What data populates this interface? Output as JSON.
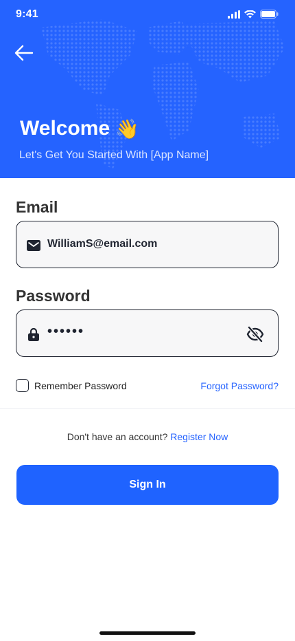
{
  "status_bar": {
    "time": "9:41",
    "icons": [
      "signal-icon",
      "wifi-icon",
      "battery-icon"
    ]
  },
  "header": {
    "back_icon": "arrow-left-icon",
    "title": "Welcome",
    "emoji": "👋",
    "subtitle": "Let's Get You Started With [App Name]"
  },
  "form": {
    "email": {
      "label": "Email",
      "value": "WilliamS@email.com",
      "icon": "envelope-icon"
    },
    "password": {
      "label": "Password",
      "masked_value": "••••••",
      "icon": "lock-icon",
      "toggle_icon": "eye-off-icon"
    },
    "remember": {
      "label": "Remember Password",
      "checked": false
    },
    "forgot_link": "Forgot Password?"
  },
  "register": {
    "prompt": "Don't have an account?",
    "link": "Register Now"
  },
  "signin_button": "Sign In",
  "colors": {
    "primary": "#2563ff",
    "text": "#1f2430",
    "field_bg": "#f7f7f8"
  }
}
